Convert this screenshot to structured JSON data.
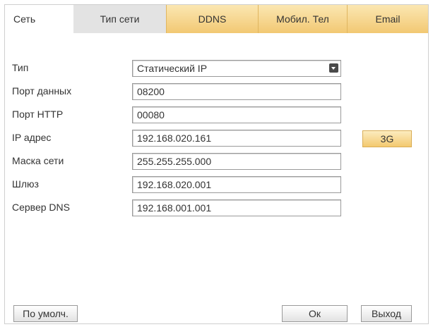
{
  "tabs": [
    {
      "label": "Сеть"
    },
    {
      "label": "Тип сети"
    },
    {
      "label": "DDNS"
    },
    {
      "label": "Мобил. Тел"
    },
    {
      "label": "Email"
    }
  ],
  "form": {
    "type_label": "Тип",
    "type_value": "Статический IP",
    "data_port_label": "Порт данных",
    "data_port_value": "08200",
    "http_port_label": "Порт HTTP",
    "http_port_value": "00080",
    "ip_label": "IP адрес",
    "ip_value": "192.168.020.161",
    "mask_label": "Маска сети",
    "mask_value": "255.255.255.000",
    "gateway_label": "Шлюз",
    "gateway_value": "192.168.020.001",
    "dns_label": "Сервер DNS",
    "dns_value": "192.168.001.001"
  },
  "buttons": {
    "g3": "3G",
    "default": "По умолч.",
    "ok": "Ок",
    "exit": "Выход"
  }
}
